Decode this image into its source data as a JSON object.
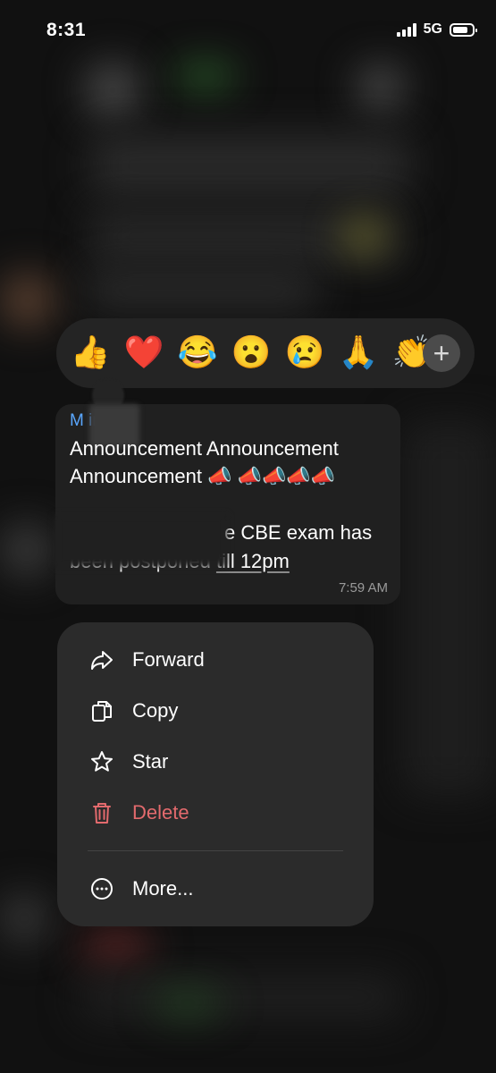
{
  "status_bar": {
    "time": "8:31",
    "network": "5G"
  },
  "reactions": {
    "emojis": [
      "👍",
      "❤️",
      "😂",
      "😮",
      "😢",
      "🙏",
      "👏"
    ],
    "add_symbol": "+"
  },
  "message": {
    "sender": "M          ir",
    "line1": "Announcement Announcement",
    "line2_text": "Announcement",
    "line2_emoji": "📣 📣📣📣📣",
    "line3": "e CBE exam has",
    "line4_text": "been postponed ",
    "line4_link": "till 12pm",
    "time": "7:59 AM"
  },
  "menu": {
    "items": [
      {
        "label": "Forward",
        "icon": "forward-icon"
      },
      {
        "label": "Copy",
        "icon": "copy-icon"
      },
      {
        "label": "Star",
        "icon": "star-icon"
      },
      {
        "label": "Delete",
        "icon": "trash-icon"
      },
      {
        "label": "More...",
        "icon": "more-icon"
      }
    ],
    "danger_color": "#e36a6d"
  }
}
